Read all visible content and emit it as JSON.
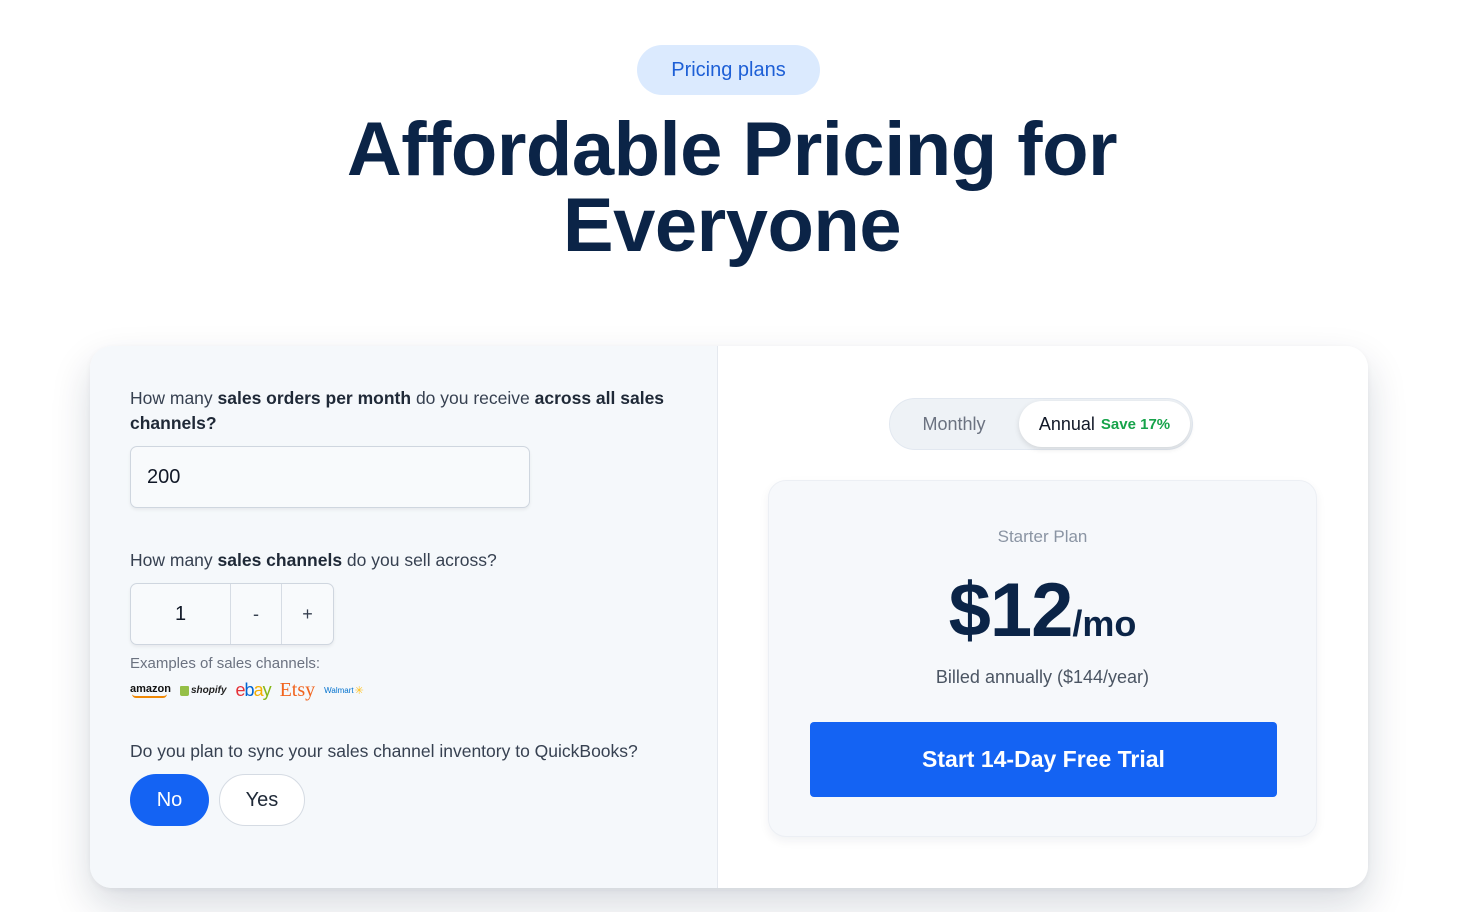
{
  "header": {
    "badge": "Pricing plans",
    "title_line1": "Affordable Pricing for",
    "title_line2": "Everyone"
  },
  "calculator": {
    "q1_pre": "How many ",
    "q1_bold1": "sales orders per month",
    "q1_mid": " do you receive ",
    "q1_bold2": "across all sales channels?",
    "orders_value": "200",
    "q2_pre": "How many ",
    "q2_bold": "sales channels",
    "q2_post": " do you sell across?",
    "channels_value": "1",
    "minus_label": "-",
    "plus_label": "+",
    "examples_label": "Examples of sales channels:",
    "logos": {
      "amazon": "amazon",
      "shopify": "shopify",
      "ebay_e": "e",
      "ebay_b": "b",
      "ebay_a": "a",
      "ebay_y": "y",
      "etsy": "Etsy",
      "walmart": "Walmart",
      "walmart_spark": "✳"
    },
    "q3": "Do you plan to sync your sales channel inventory to QuickBooks?",
    "no_label": "No",
    "yes_label": "Yes"
  },
  "billing": {
    "monthly_label": "Monthly",
    "annual_label": "Annual",
    "save_label": "Save 17%"
  },
  "plan": {
    "name": "Starter Plan",
    "price": "$12",
    "per": "/mo",
    "billed": "Billed annually ($144/year)",
    "cta": "Start 14-Day Free Trial"
  },
  "colors": {
    "primary": "#1463f3",
    "heading": "#0b2447",
    "save": "#16a34a",
    "badge_bg": "#dbeafe"
  }
}
